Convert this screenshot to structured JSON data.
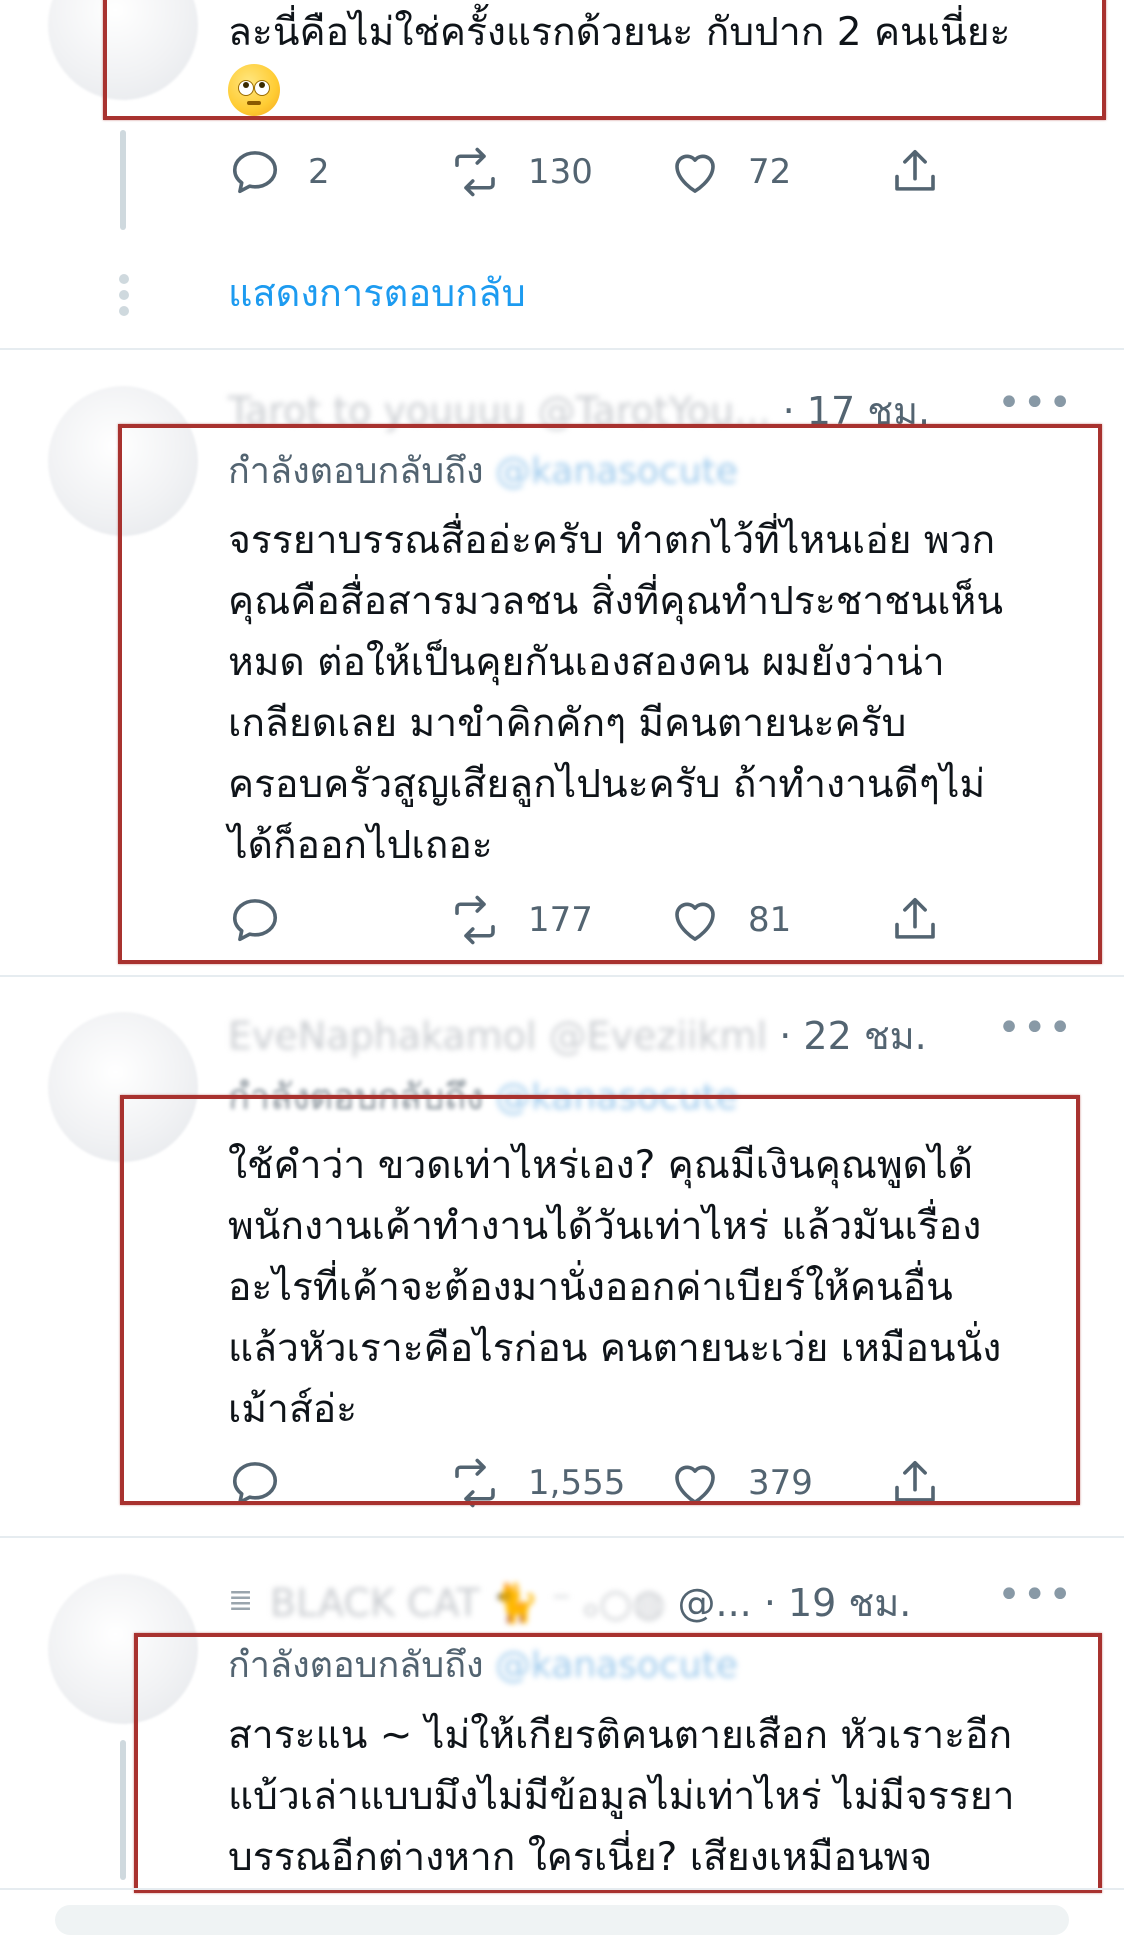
{
  "tweet1": {
    "body_line1": "ละนี่คือไม่ใช่ครั้งแรกด้วยนะ กับปาก 2 คนเนี่ยะ",
    "emoji": "face-with-rolling-eyes",
    "replies": "2",
    "retweets": "130",
    "likes": "72",
    "show_replies": "แสดงการตอบกลับ"
  },
  "tweet2": {
    "display_name": "Tarot to youuuu",
    "handle": "@TarotYou...",
    "time": "· 17 ชม.",
    "replying_label": "กำลังตอบกลับถึง",
    "replying_handle": "@kanasocute",
    "body": [
      "จรรยาบรรณสื่ออ่ะครับ ทำตกไว้ที่ไหนเอ่ย พวก",
      "คุณคือสื่อสารมวลชน สิ่งที่คุณทำประชาชนเห็น",
      "หมด  ต่อให้เป็นคุยกันเองสองคน ผมยังว่าน่า",
      "เกลียดเลย มาขำคิกคักๆ มีคนตายนะครับ",
      "ครอบครัวสูญเสียลูกไปนะครับ  ถ้าทำงานดีๆไม่",
      "ได้ก็ออกไปเถอะ"
    ],
    "replies": "",
    "retweets": "177",
    "likes": "81"
  },
  "tweet3": {
    "display_name": "EveNaphakamol",
    "handle": "@Eveziikml",
    "time": "· 22 ชม.",
    "replying_label": "กำลังตอบกลับถึง",
    "replying_handle": "@kanasocute",
    "body": [
      "ใช้คำว่า ขวดเท่าไหร่เอง? คุณมีเงินคุณพูดได้",
      "พนักงานเค้าทำงานได้วันเท่าไหร่ แล้วมันเรื่อง",
      "อะไรที่เค้าจะต้องมานั่งออกค่าเบียร์ให้คนอื่น",
      "แล้วหัวเราะคือไรก่อน คนตายนะเว่ย เหมือนนั่ง",
      "เม้าส์อ่ะ"
    ],
    "replies": "",
    "retweets": "1,555",
    "likes": "379"
  },
  "tweet4": {
    "display_name": "BLACK CAT 🐈 ⁻ ₒ○◍",
    "handle": "@...",
    "time": "· 19 ชม.",
    "replying_label": "กำลังตอบกลับถึง",
    "replying_handle": "@kanasocute",
    "body": [
      "สาระแน ~ ไม่ให้เกียรติคนตายเสือก หัวเราะอีก",
      "แบ้วเล่าแบบมึงไม่มีข้อมูลไม่เท่าไหร่ ไม่มีจรรยา",
      "บรรณอีกต่างหาก ใครเนี่ย? เสียงเหมือนพจ"
    ]
  },
  "more_label": "•••",
  "colors": {
    "highlight_border": "#a8322f",
    "link_blue": "#1d9bf0",
    "secondary_text": "#536471"
  }
}
